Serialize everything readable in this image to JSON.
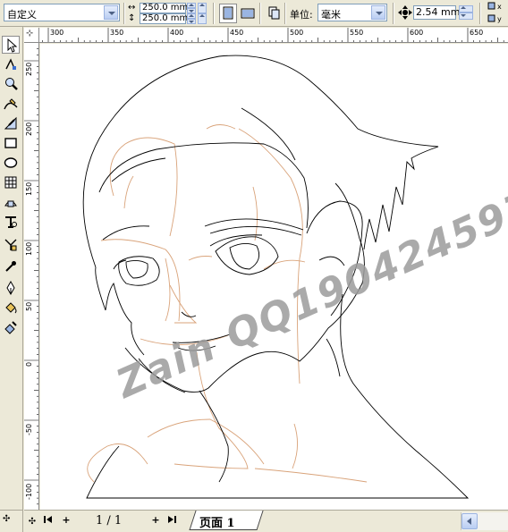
{
  "propbar": {
    "preset_value": "自定义",
    "width_value": "250.0 mm",
    "height_value": "250.0 mm",
    "units_label": "单位:",
    "units_value": "毫米",
    "nudge_value": "2.54 mm"
  },
  "toolbox": {
    "tools": [
      {
        "name": "pick-tool-icon"
      },
      {
        "name": "shape-tool-icon"
      },
      {
        "name": "zoom-tool-icon"
      },
      {
        "name": "freehand-tool-icon"
      },
      {
        "name": "smart-fill-tool-icon"
      },
      {
        "name": "rectangle-tool-icon"
      },
      {
        "name": "ellipse-tool-icon"
      },
      {
        "name": "graph-paper-tool-icon"
      },
      {
        "name": "basic-shapes-tool-icon"
      },
      {
        "name": "text-tool-icon"
      },
      {
        "name": "interactive-blend-tool-icon"
      },
      {
        "name": "eyedropper-tool-icon"
      },
      {
        "name": "outline-pen-tool-icon"
      },
      {
        "name": "fill-tool-icon"
      },
      {
        "name": "interactive-fill-tool-icon"
      }
    ]
  },
  "ruler": {
    "horizontal_labels": [
      "300",
      "350",
      "400",
      "450",
      "500",
      "550",
      "600",
      "650"
    ],
    "vertical_labels": [
      "250",
      "200",
      "150",
      "100",
      "50",
      "0",
      "-50",
      "-100"
    ]
  },
  "canvas": {
    "watermark": "Zain QQ190424597"
  },
  "bottombar": {
    "page_count": "1 / 1",
    "page_tab": "页面 1"
  },
  "colors": {
    "ui_background": "#ece9d8",
    "sketch_lines": "#000000",
    "guide_lines": "#d9a37a",
    "watermark": "#9c9c9c"
  }
}
